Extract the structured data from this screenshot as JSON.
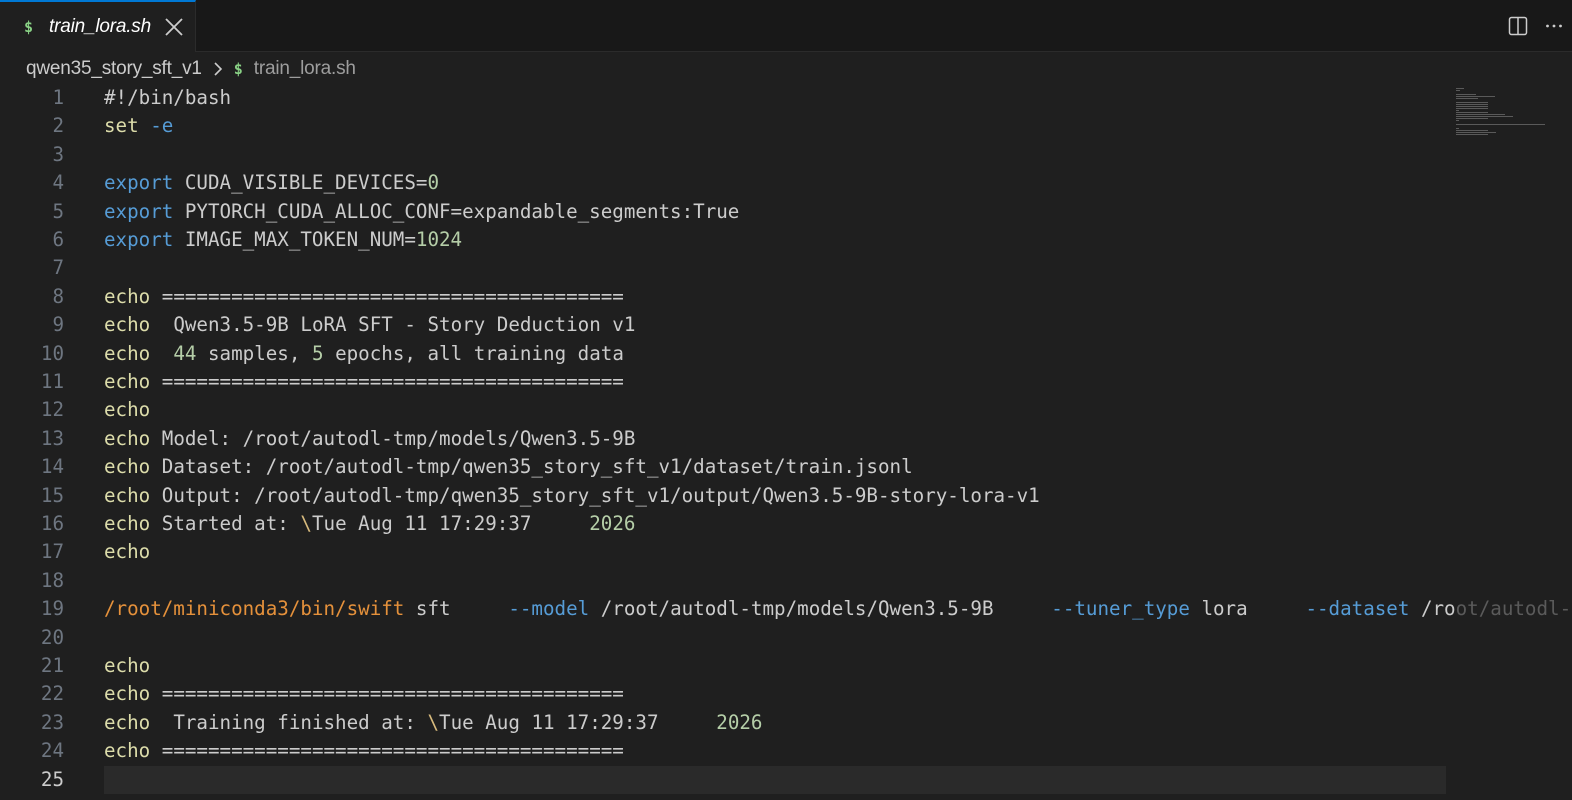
{
  "tab": {
    "icon": "dollar-icon",
    "title": "train_lora.sh",
    "close_icon": "close-icon"
  },
  "actions": {
    "split_icon": "split-editor-icon",
    "more_icon": "more-actions-icon"
  },
  "breadcrumb": {
    "folder": "qwen35_story_sft_v1",
    "separator_icon": "chevron-right-icon",
    "file_icon": "dollar-icon",
    "file": "train_lora.sh"
  },
  "colors": {
    "accent": "#0078d4",
    "shell_icon": "#89d185",
    "background": "#1f1f1f"
  },
  "editor": {
    "active_line": "25",
    "lines": [
      {
        "n": "1",
        "tokens": [
          {
            "c": "t-plain",
            "t": "#!/bin/bash"
          }
        ]
      },
      {
        "n": "2",
        "tokens": [
          {
            "c": "t-cmd",
            "t": "set"
          },
          {
            "c": "t-flag",
            "t": " -e"
          }
        ]
      },
      {
        "n": "3",
        "tokens": []
      },
      {
        "n": "4",
        "tokens": [
          {
            "c": "t-kw",
            "t": "export"
          },
          {
            "c": "t-plain",
            "t": " CUDA_VISIBLE_DEVICES="
          },
          {
            "c": "t-num",
            "t": "0"
          }
        ]
      },
      {
        "n": "5",
        "tokens": [
          {
            "c": "t-kw",
            "t": "export"
          },
          {
            "c": "t-plain",
            "t": " PYTORCH_CUDA_ALLOC_CONF=expandable_segments:True"
          }
        ]
      },
      {
        "n": "6",
        "tokens": [
          {
            "c": "t-kw",
            "t": "export"
          },
          {
            "c": "t-plain",
            "t": " IMAGE_MAX_TOKEN_NUM="
          },
          {
            "c": "t-num",
            "t": "1024"
          }
        ]
      },
      {
        "n": "7",
        "tokens": []
      },
      {
        "n": "8",
        "tokens": [
          {
            "c": "t-cmd",
            "t": "echo"
          },
          {
            "c": "t-plain",
            "t": " ========================================"
          }
        ]
      },
      {
        "n": "9",
        "tokens": [
          {
            "c": "t-cmd",
            "t": "echo"
          },
          {
            "c": "t-plain",
            "t": "  Qwen3.5-9B LoRA SFT - Story Deduction v1"
          }
        ]
      },
      {
        "n": "10",
        "tokens": [
          {
            "c": "t-cmd",
            "t": "echo"
          },
          {
            "c": "t-plain",
            "t": "  "
          },
          {
            "c": "t-num",
            "t": "44"
          },
          {
            "c": "t-plain",
            "t": " samples, "
          },
          {
            "c": "t-num",
            "t": "5"
          },
          {
            "c": "t-plain",
            "t": " epochs, all training data"
          }
        ]
      },
      {
        "n": "11",
        "tokens": [
          {
            "c": "t-cmd",
            "t": "echo"
          },
          {
            "c": "t-plain",
            "t": " ========================================"
          }
        ]
      },
      {
        "n": "12",
        "tokens": [
          {
            "c": "t-cmd",
            "t": "echo"
          }
        ]
      },
      {
        "n": "13",
        "tokens": [
          {
            "c": "t-cmd",
            "t": "echo"
          },
          {
            "c": "t-plain",
            "t": " Model: /root/autodl-tmp/models/Qwen3.5-9B"
          }
        ]
      },
      {
        "n": "14",
        "tokens": [
          {
            "c": "t-cmd",
            "t": "echo"
          },
          {
            "c": "t-plain",
            "t": " Dataset: /root/autodl-tmp/qwen35_story_sft_v1/dataset/train.jsonl"
          }
        ]
      },
      {
        "n": "15",
        "tokens": [
          {
            "c": "t-cmd",
            "t": "echo"
          },
          {
            "c": "t-plain",
            "t": " Output: /root/autodl-tmp/qwen35_story_sft_v1/output/Qwen3.5-9B-story-lora-v1"
          }
        ]
      },
      {
        "n": "16",
        "tokens": [
          {
            "c": "t-cmd",
            "t": "echo"
          },
          {
            "c": "t-plain",
            "t": " Started at: "
          },
          {
            "c": "t-esc",
            "t": "\\"
          },
          {
            "c": "t-plain",
            "t": "Tue Aug 11 17:29:37     "
          },
          {
            "c": "t-num",
            "t": "2026"
          }
        ]
      },
      {
        "n": "17",
        "tokens": [
          {
            "c": "t-cmd",
            "t": "echo"
          }
        ]
      },
      {
        "n": "18",
        "tokens": []
      },
      {
        "n": "19",
        "tokens": [
          {
            "c": "t-exe",
            "t": "/root/miniconda3/bin/swift"
          },
          {
            "c": "t-plain",
            "t": " sft     "
          },
          {
            "c": "t-flag",
            "t": "--model"
          },
          {
            "c": "t-plain",
            "t": " /root/autodl-tmp/models/Qwen3.5-9B     "
          },
          {
            "c": "t-flag",
            "t": "--tuner_type"
          },
          {
            "c": "t-plain",
            "t": " lora     "
          },
          {
            "c": "t-flag",
            "t": "--dataset"
          },
          {
            "c": "t-plain",
            "t": " /ro"
          },
          {
            "c": "t-faded",
            "t": "ot/autodl-"
          }
        ]
      },
      {
        "n": "20",
        "tokens": []
      },
      {
        "n": "21",
        "tokens": [
          {
            "c": "t-cmd",
            "t": "echo"
          }
        ]
      },
      {
        "n": "22",
        "tokens": [
          {
            "c": "t-cmd",
            "t": "echo"
          },
          {
            "c": "t-plain",
            "t": " ========================================"
          }
        ]
      },
      {
        "n": "23",
        "tokens": [
          {
            "c": "t-cmd",
            "t": "echo"
          },
          {
            "c": "t-plain",
            "t": "  Training finished at: "
          },
          {
            "c": "t-esc",
            "t": "\\"
          },
          {
            "c": "t-plain",
            "t": "Tue Aug 11 17:29:37     "
          },
          {
            "c": "t-num",
            "t": "2026"
          }
        ]
      },
      {
        "n": "24",
        "tokens": [
          {
            "c": "t-cmd",
            "t": "echo"
          },
          {
            "c": "t-plain",
            "t": " ========================================"
          }
        ]
      },
      {
        "n": "25",
        "tokens": []
      }
    ]
  }
}
